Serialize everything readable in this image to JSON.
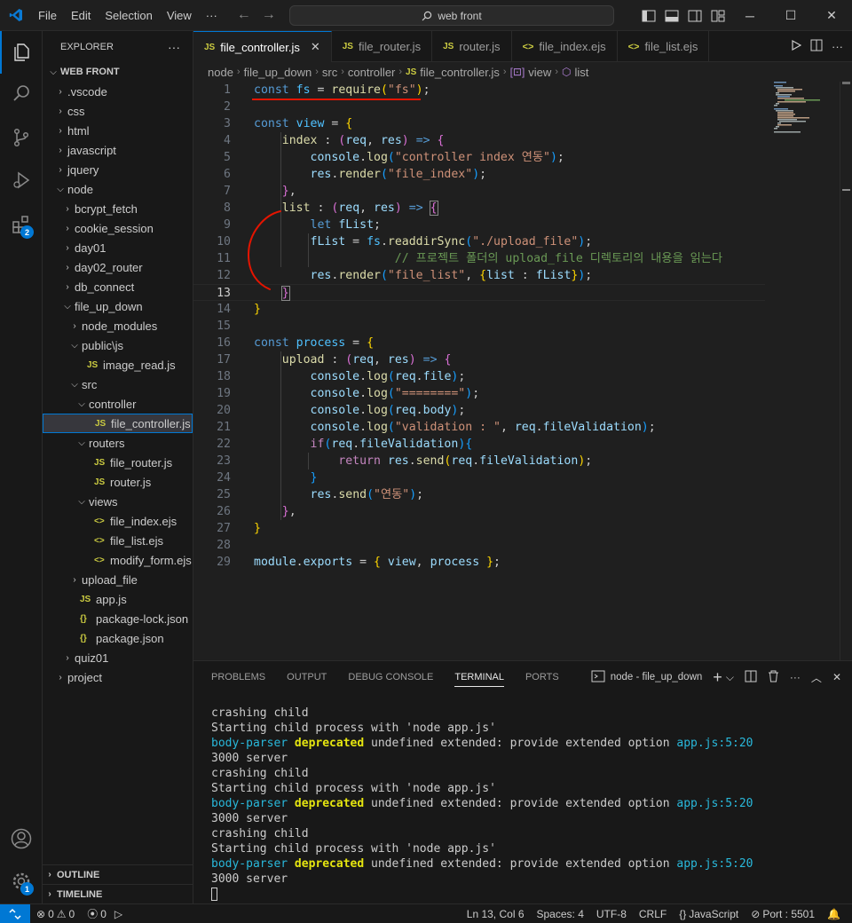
{
  "titlebar": {
    "menu": [
      "File",
      "Edit",
      "Selection",
      "View",
      "···"
    ],
    "search_text": "web front"
  },
  "activity": {
    "extensions_badge": "2",
    "manage_badge": "1"
  },
  "sidebar": {
    "title": "EXPLORER",
    "more": "···",
    "root": "WEB FRONT",
    "outline": "OUTLINE",
    "timeline": "TIMELINE",
    "tree": [
      {
        "label": ".vscode",
        "depth": 1,
        "kind": "folder",
        "open": false
      },
      {
        "label": "css",
        "depth": 1,
        "kind": "folder",
        "open": false
      },
      {
        "label": "html",
        "depth": 1,
        "kind": "folder",
        "open": false
      },
      {
        "label": "javascript",
        "depth": 1,
        "kind": "folder",
        "open": false
      },
      {
        "label": "jquery",
        "depth": 1,
        "kind": "folder",
        "open": false
      },
      {
        "label": "node",
        "depth": 1,
        "kind": "folder",
        "open": true
      },
      {
        "label": "bcrypt_fetch",
        "depth": 2,
        "kind": "folder",
        "open": false
      },
      {
        "label": "cookie_session",
        "depth": 2,
        "kind": "folder",
        "open": false
      },
      {
        "label": "day01",
        "depth": 2,
        "kind": "folder",
        "open": false
      },
      {
        "label": "day02_router",
        "depth": 2,
        "kind": "folder",
        "open": false
      },
      {
        "label": "db_connect",
        "depth": 2,
        "kind": "folder",
        "open": false
      },
      {
        "label": "file_up_down",
        "depth": 2,
        "kind": "folder",
        "open": true
      },
      {
        "label": "node_modules",
        "depth": 3,
        "kind": "folder",
        "open": false
      },
      {
        "label": "public\\js",
        "depth": 3,
        "kind": "folder",
        "open": true
      },
      {
        "label": "image_read.js",
        "depth": 4,
        "kind": "js"
      },
      {
        "label": "src",
        "depth": 3,
        "kind": "folder",
        "open": true
      },
      {
        "label": "controller",
        "depth": 4,
        "kind": "folder",
        "open": true
      },
      {
        "label": "file_controller.js",
        "depth": 5,
        "kind": "js",
        "selected": true
      },
      {
        "label": "routers",
        "depth": 4,
        "kind": "folder",
        "open": true
      },
      {
        "label": "file_router.js",
        "depth": 5,
        "kind": "js"
      },
      {
        "label": "router.js",
        "depth": 5,
        "kind": "js"
      },
      {
        "label": "views",
        "depth": 4,
        "kind": "folder",
        "open": true
      },
      {
        "label": "file_index.ejs",
        "depth": 5,
        "kind": "ejs"
      },
      {
        "label": "file_list.ejs",
        "depth": 5,
        "kind": "ejs"
      },
      {
        "label": "modify_form.ejs",
        "depth": 5,
        "kind": "ejs"
      },
      {
        "label": "upload_file",
        "depth": 3,
        "kind": "folder",
        "open": false
      },
      {
        "label": "app.js",
        "depth": 3,
        "kind": "js"
      },
      {
        "label": "package-lock.json",
        "depth": 3,
        "kind": "json"
      },
      {
        "label": "package.json",
        "depth": 3,
        "kind": "json"
      },
      {
        "label": "quiz01",
        "depth": 2,
        "kind": "folder",
        "open": false
      },
      {
        "label": "project",
        "depth": 1,
        "kind": "folder",
        "open": false
      }
    ]
  },
  "tabs": [
    {
      "label": "file_controller.js",
      "icon": "JS",
      "active": true
    },
    {
      "label": "file_router.js",
      "icon": "JS"
    },
    {
      "label": "router.js",
      "icon": "JS"
    },
    {
      "label": "file_index.ejs",
      "icon": "<>"
    },
    {
      "label": "file_list.ejs",
      "icon": "<>"
    }
  ],
  "breadcrumb": {
    "parts": [
      "node",
      "file_up_down",
      "src",
      "controller"
    ],
    "file": "file_controller.js",
    "symbol1": "view",
    "symbol2": "list"
  },
  "editor": {
    "current_line": 13,
    "line_numbers": [
      "1",
      "2",
      "3",
      "4",
      "5",
      "6",
      "7",
      "8",
      "9",
      "10",
      "11",
      "12",
      "13",
      "14",
      "15",
      "16",
      "17",
      "18",
      "19",
      "20",
      "21",
      "22",
      "23",
      "24",
      "25",
      "26",
      "27",
      "28",
      "29"
    ]
  },
  "panel": {
    "tabs": [
      "PROBLEMS",
      "OUTPUT",
      "DEBUG CONSOLE",
      "TERMINAL",
      "PORTS"
    ],
    "active_tab": "TERMINAL",
    "terminal_name": "node - file_up_down",
    "lines": [
      "crashing child",
      "Starting child process with 'node app.js'",
      "BP",
      "3000 server",
      "crashing child",
      "Starting child process with 'node app.js'",
      "BP",
      "3000 server",
      "crashing child",
      "Starting child process with 'node app.js'",
      "BP",
      "3000 server"
    ],
    "bp_module": "body-parser",
    "bp_deprecated": "deprecated",
    "bp_msg": " undefined extended: provide extended option ",
    "bp_loc": "app.js:5:20"
  },
  "statusbar": {
    "errors": "0",
    "warnings": "0",
    "ports": "0",
    "position": "Ln 13, Col 6",
    "spaces": "Spaces: 4",
    "encoding": "UTF-8",
    "eol": "CRLF",
    "language": "JavaScript",
    "port": "Port : 5501"
  },
  "colors": {
    "accent": "#0078d4",
    "annotation_red": "#e51400"
  }
}
